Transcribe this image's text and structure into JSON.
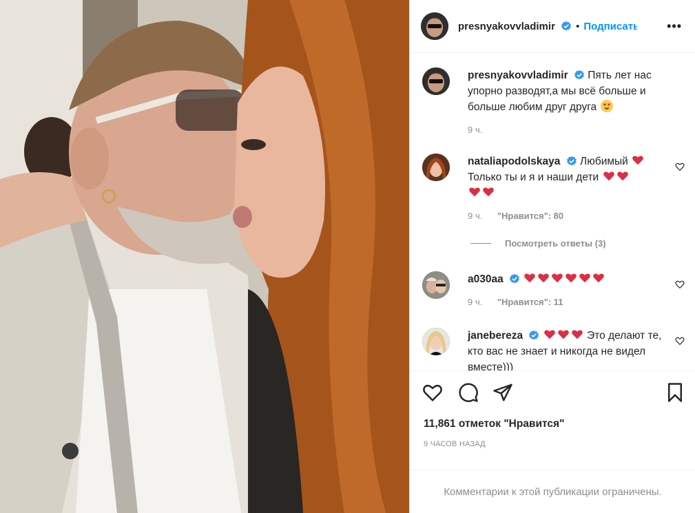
{
  "post": {
    "photo_label": "post-photo"
  },
  "header": {
    "username": "presnyakovvladimir",
    "separator": "•",
    "follow_label": "Подписаться",
    "more_label": "•••"
  },
  "caption": {
    "username": "presnyakovvladimir",
    "text": "Пять лет нас упорно разводят,а мы всё больше и больше любим друг друга",
    "time": "9 ч."
  },
  "comments": [
    {
      "username": "nataliapodolskaya",
      "text_1": "Любимый",
      "text_2": "Только ты и я и наши дети",
      "time": "9 ч.",
      "likes": "\"Нравится\": 80"
    },
    {
      "username": "a030aa",
      "text_1": "",
      "time": "9 ч.",
      "likes": "\"Нравится\": 11"
    },
    {
      "username": "janebereza",
      "text_1": "Это делают те, кто вас не знает и никогда не видел вместе)))"
    }
  ],
  "view_replies": "Посмотреть ответы (3)",
  "likes_total": "11,861 отметок \"Нравится\"",
  "posted_ago": "9 ЧАСОВ НАЗАД",
  "restricted": "Комментарии к этой публикации ограничены.",
  "colors": {
    "accent": "#0095f6",
    "heart": "#ed4956",
    "muted": "#8e8e8e",
    "text": "#262626"
  }
}
